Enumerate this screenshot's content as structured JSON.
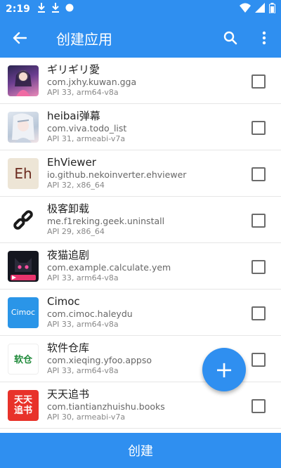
{
  "status_bar": {
    "time": "2:19",
    "icons": [
      "download-icon",
      "download-icon",
      "circle-icon"
    ],
    "right_icons": [
      "wifi-icon",
      "signal-icon",
      "battery-icon"
    ]
  },
  "app_bar": {
    "title": "创建应用",
    "back_icon": "arrow-back-icon",
    "search_icon": "search-icon",
    "more_icon": "more-vert-icon"
  },
  "apps": [
    {
      "name": "ギリギリ愛",
      "package": "com.jxhy.kuwan.gga",
      "meta": "API 33, arm64-v8a",
      "icon": "anime-girl-icon",
      "checked": false
    },
    {
      "name": "heibai弹幕",
      "package": "com.viva.todo_list",
      "meta": "API 31, armeabi-v7a",
      "icon": "anime-girl-icon",
      "checked": false
    },
    {
      "name": "EhViewer",
      "package": "io.github.nekoinverter.ehviewer",
      "meta": "API 32, x86_64",
      "icon": "eh-logo-icon",
      "icon_text": "Eh",
      "checked": false
    },
    {
      "name": "极客卸载",
      "package": "me.f1reking.geek.uninstall",
      "meta": "API 29, x86_64",
      "icon": "link-icon",
      "checked": false
    },
    {
      "name": "夜猫追剧",
      "package": "com.example.calculate.yem",
      "meta": "API 33, arm64-v8a",
      "icon": "cat-icon",
      "checked": false
    },
    {
      "name": "Cimoc",
      "package": "com.cimoc.haleydu",
      "meta": "API 33, arm64-v8a",
      "icon": "cimoc-logo-icon",
      "icon_text": "Cimoc",
      "checked": false
    },
    {
      "name": "软件仓库",
      "package": "com.xieqing.yfoo.appso",
      "meta": "API 33, arm64-v8a",
      "icon": "store-logo-icon",
      "icon_text": "软仓",
      "checked": false
    },
    {
      "name": "天天追书",
      "package": "com.tiantianzhuishu.books",
      "meta": "API 30, armeabi-v7a",
      "icon": "book-logo-icon",
      "icon_text": "天天追书",
      "checked": false
    }
  ],
  "fab": {
    "icon": "plus-icon",
    "label": "+"
  },
  "bottom_button": {
    "label": "创建"
  },
  "colors": {
    "primary": "#2f8ff0",
    "white": "#ffffff"
  }
}
